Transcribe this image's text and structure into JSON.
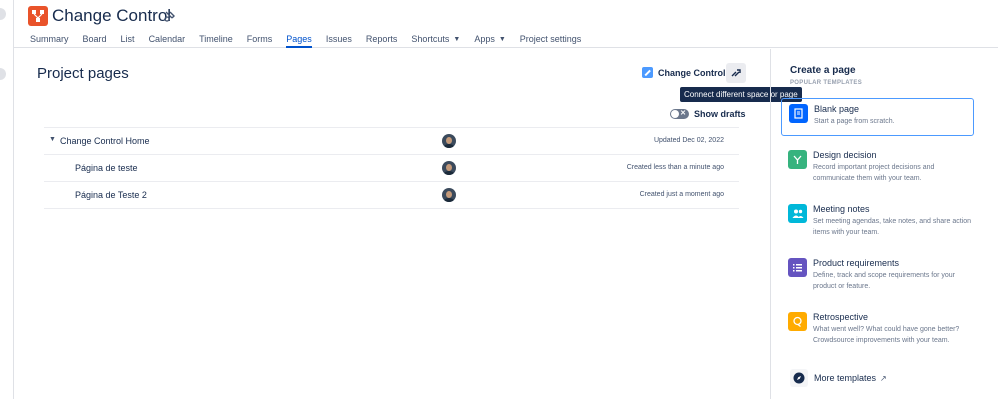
{
  "header": {
    "title": "Change Control",
    "tabs": [
      {
        "label": "Summary",
        "active": false
      },
      {
        "label": "Board",
        "active": false
      },
      {
        "label": "List",
        "active": false
      },
      {
        "label": "Calendar",
        "active": false
      },
      {
        "label": "Timeline",
        "active": false
      },
      {
        "label": "Forms",
        "active": false
      },
      {
        "label": "Pages",
        "active": true
      },
      {
        "label": "Issues",
        "active": false
      },
      {
        "label": "Reports",
        "active": false
      },
      {
        "label": "Shortcuts",
        "active": false,
        "dropdown": true
      },
      {
        "label": "Apps",
        "active": false,
        "dropdown": true
      },
      {
        "label": "Project settings",
        "active": false
      }
    ]
  },
  "main": {
    "title": "Project pages",
    "space_link": "Change Control",
    "tooltip": "Connect different space or page",
    "show_drafts": "Show drafts",
    "rows": [
      {
        "name": "Change Control Home",
        "status": "Updated Dec 02, 2022",
        "expandable": true
      },
      {
        "name": "Página de teste",
        "status": "Created less than a minute ago",
        "expandable": false
      },
      {
        "name": "Página de Teste 2",
        "status": "Created just a moment ago",
        "expandable": false
      }
    ]
  },
  "sidebar": {
    "title": "Create a page",
    "popular_label": "POPULAR TEMPLATES",
    "templates": [
      {
        "name": "Blank page",
        "desc": "Start a page from scratch.",
        "color": "#0065ff",
        "icon": "document-icon"
      },
      {
        "name": "Design decision",
        "desc": "Record important project decisions and communicate them with your team.",
        "color": "#36b37e",
        "icon": "branch-icon"
      },
      {
        "name": "Meeting notes",
        "desc": "Set meeting agendas, take notes, and share action items with your team.",
        "color": "#00b8d9",
        "icon": "people-icon"
      },
      {
        "name": "Product requirements",
        "desc": "Define, track and scope requirements for your product or feature.",
        "color": "#6554c0",
        "icon": "list-icon"
      },
      {
        "name": "Retrospective",
        "desc": "What went well? What could have gone better? Crowdsource improvements with your team.",
        "color": "#ffab00",
        "icon": "chat-icon"
      }
    ],
    "more_templates": "More templates"
  },
  "colors": {
    "accent": "#0052cc",
    "logo": "#e9532a",
    "selected_border": "#4c9aff"
  }
}
